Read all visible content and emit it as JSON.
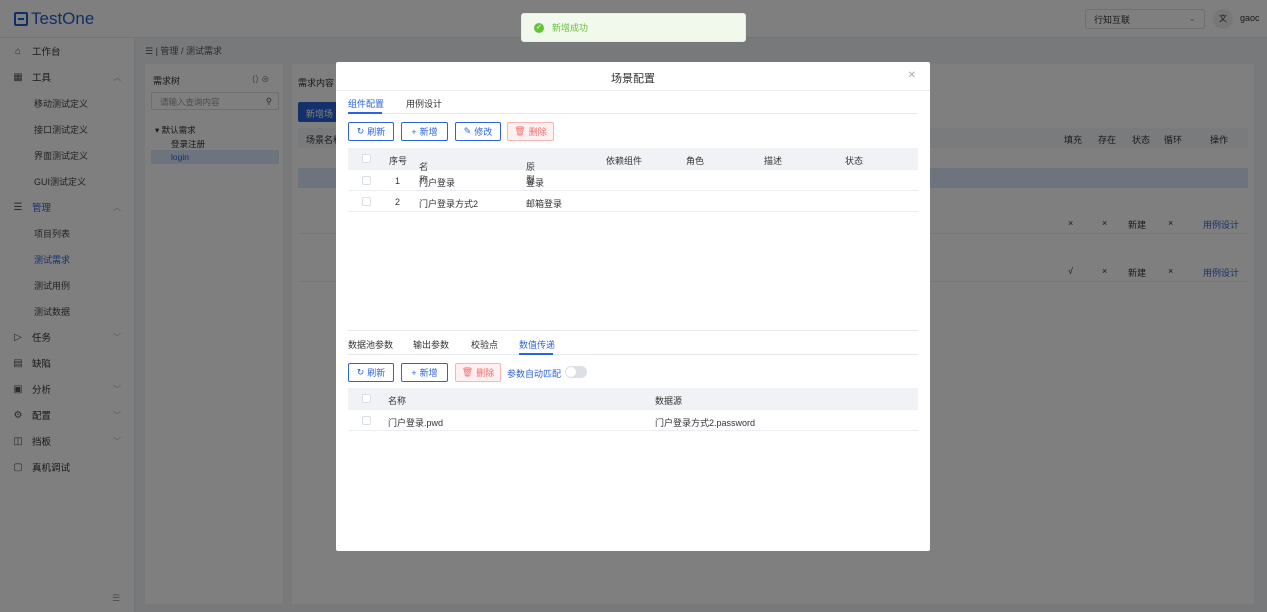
{
  "app": {
    "logo": "TestOne",
    "org_select": "行知互联",
    "lang_badge": "文",
    "user": "gaoc"
  },
  "sidebar": {
    "workbench": "工作台",
    "tools": "工具",
    "tool_items": [
      "移动测试定义",
      "接口测试定义",
      "界面测试定义",
      "GUI测试定义"
    ],
    "manage": "管理",
    "manage_items": [
      "项目列表",
      "测试需求",
      "测试用例",
      "测试数据"
    ],
    "task": "任务",
    "defect": "缺陷",
    "analysis": "分析",
    "config": "配置",
    "board": "挡板",
    "device": "真机调试"
  },
  "breadcrumb": {
    "root": "管理",
    "current": "测试需求"
  },
  "tree": {
    "title": "需求树",
    "search_placeholder": "请输入查询内容",
    "root": "默认需求",
    "children": [
      "登录注册",
      "login"
    ]
  },
  "main": {
    "title": "需求内容",
    "new_button": "新增场",
    "col_scene": "场景名称",
    "cols_right": [
      "填充",
      "存在",
      "状态",
      "循环",
      "操作"
    ],
    "rows": [
      {
        "fill": "×",
        "exist": "×",
        "status": "新建",
        "loop": "×",
        "action": "用例设计"
      },
      {
        "fill": "√",
        "exist": "×",
        "status": "新建",
        "loop": "×",
        "action": "用例设计"
      }
    ]
  },
  "toast": {
    "message": "新增成功",
    "color": "#67c23a"
  },
  "modal": {
    "title": "场景配置",
    "top_tabs": [
      "组件配置",
      "用例设计"
    ],
    "top_buttons": {
      "refresh": "刷新",
      "add": "新增",
      "edit": "修改",
      "delete": "删除"
    },
    "component_table": {
      "headers": [
        "序号",
        "名称",
        "原型",
        "依赖组件",
        "角色",
        "描述",
        "状态"
      ],
      "rows": [
        {
          "index": "1",
          "name": "门户登录",
          "prototype": "登录"
        },
        {
          "index": "2",
          "name": "门户登录方式2",
          "prototype": "邮箱登录"
        }
      ]
    },
    "bottom_tabs": [
      "数据池参数",
      "输出参数",
      "校验点",
      "数值传递"
    ],
    "bottom_buttons": {
      "refresh": "刷新",
      "add": "新增",
      "delete": "删除"
    },
    "auto_match_label": "参数自动匹配",
    "auto_match_on": false,
    "transfer_table": {
      "headers": [
        "名称",
        "数据源"
      ],
      "rows": [
        {
          "name": "门户登录.pwd",
          "source": "门户登录方式2.password"
        }
      ]
    }
  },
  "colors": {
    "primary": "#2b63d9",
    "danger": "#f56c6c",
    "success": "#67c23a"
  }
}
